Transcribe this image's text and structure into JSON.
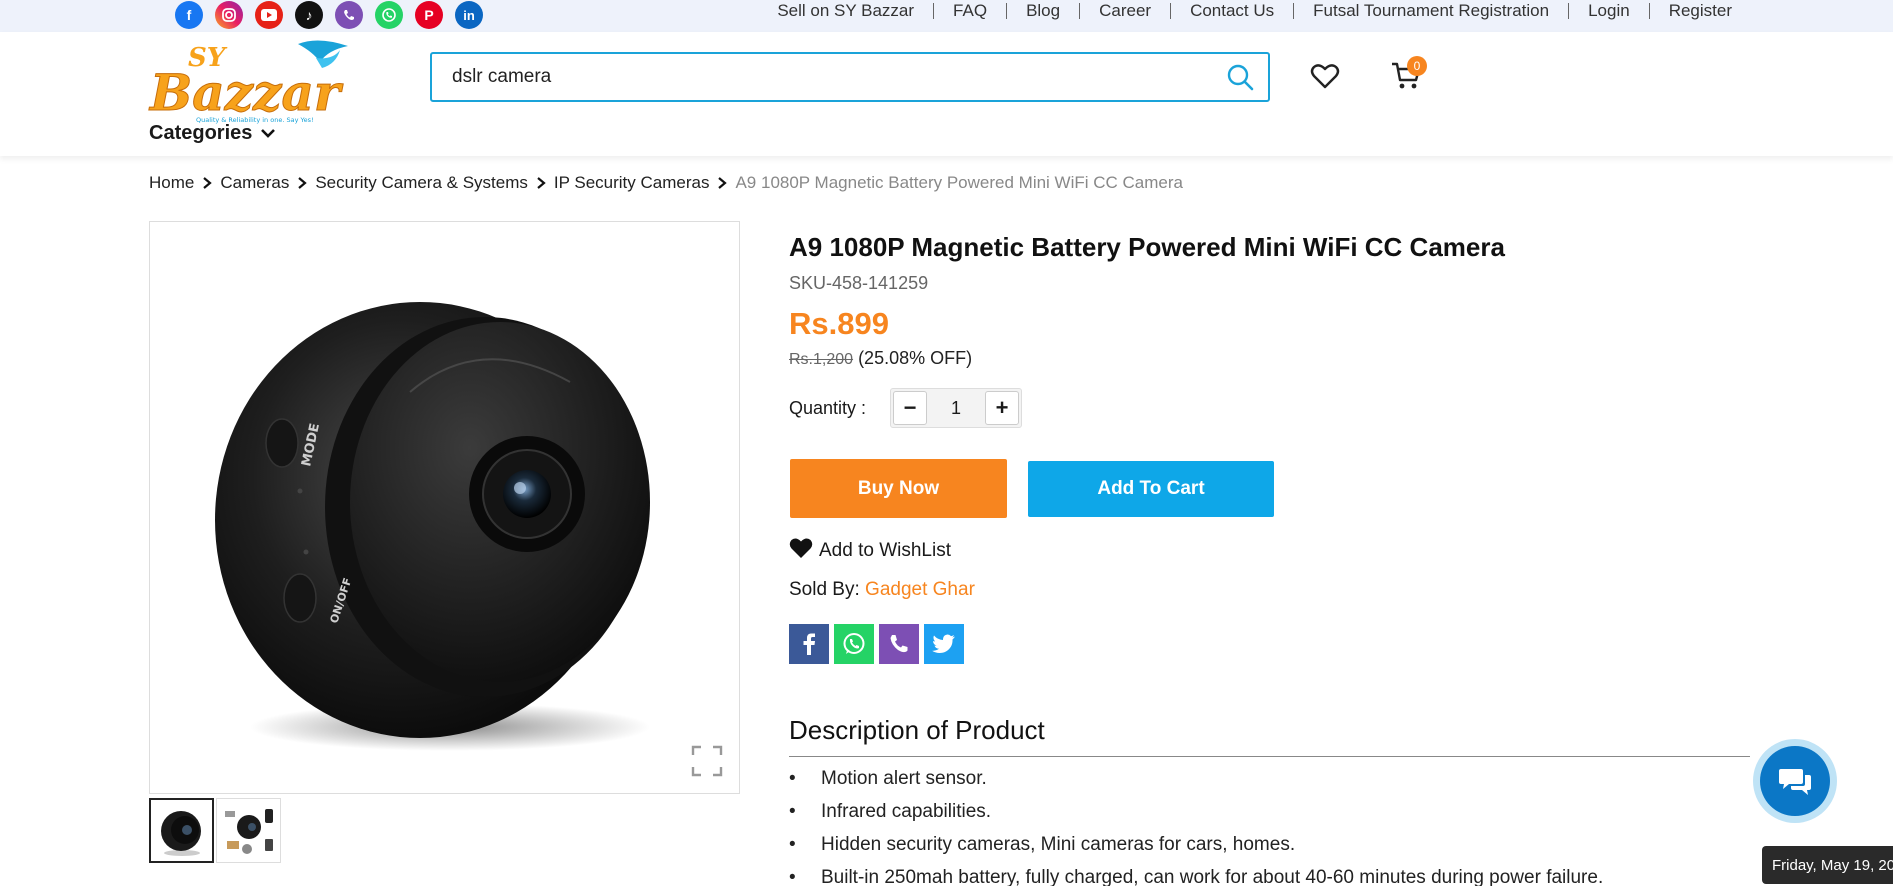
{
  "topbar": {
    "social_icons": [
      "facebook-icon",
      "instagram-icon",
      "youtube-icon",
      "tiktok-icon",
      "viber-icon",
      "whatsapp-icon",
      "pinterest-icon",
      "linkedin-icon"
    ],
    "links": [
      "Sell on SY Bazzar",
      "FAQ",
      "Blog",
      "Career",
      "Contact Us",
      "Futsal Tournament Registration",
      "Login",
      "Register"
    ]
  },
  "header": {
    "logo_text": "SY Bazzar",
    "logo_tagline": "Quality & Reliability in one. Say Yes!",
    "search_value": "dslr camera",
    "cart_count": "0",
    "categories_label": "Categories"
  },
  "breadcrumb": {
    "items": [
      "Home",
      "Cameras",
      "Security Camera & Systems",
      "IP Security Cameras"
    ],
    "current": "A9 1080P Magnetic Battery Powered Mini WiFi CC Camera"
  },
  "product": {
    "title": "A9 1080P Magnetic Battery Powered Mini WiFi CC Camera",
    "sku": "SKU-458-141259",
    "price": "Rs.899",
    "old_price": "Rs.1,200",
    "discount": "(25.08% OFF)",
    "quantity_label": "Quantity :",
    "quantity": "1",
    "buy_now": "Buy Now",
    "add_to_cart": "Add To Cart",
    "wishlist": "Add to WishList",
    "sold_by_label": "Sold By:",
    "seller": "Gadget Ghar",
    "camera_labels": [
      "MODE",
      "ON/OFF"
    ]
  },
  "description": {
    "heading": "Description of Product",
    "items": [
      "Motion alert sensor.",
      "Infrared capabilities.",
      "Hidden security cameras, Mini cameras for cars, homes.",
      "Built-in 250mah battery, fully charged, can work for about 40-60 minutes during power failure."
    ]
  },
  "tooltip": {
    "date": "Friday, May 19, 20"
  },
  "colors": {
    "accent": "#f7851f",
    "primary": "#0ea7e8",
    "chat": "#0b77c6"
  }
}
